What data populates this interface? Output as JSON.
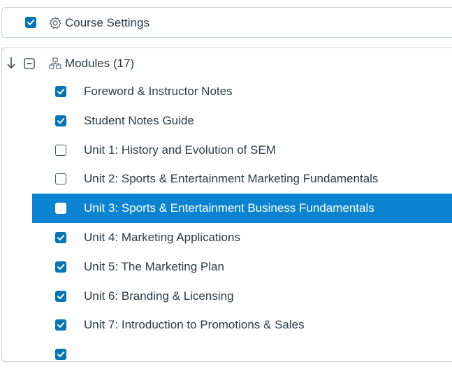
{
  "settings": {
    "label": "Course Settings",
    "checked": true
  },
  "modules": {
    "label": "Modules (17)",
    "items": [
      {
        "label": "Foreword & Instructor Notes",
        "checked": true,
        "selected": false
      },
      {
        "label": "Student Notes Guide",
        "checked": true,
        "selected": false
      },
      {
        "label": "Unit 1: History and Evolution of SEM",
        "checked": false,
        "selected": false
      },
      {
        "label": "Unit 2: Sports & Entertainment Marketing Fundamentals",
        "checked": false,
        "selected": false
      },
      {
        "label": "Unit 3: Sports & Entertainment Business Fundamentals",
        "checked": false,
        "selected": true
      },
      {
        "label": "Unit 4: Marketing Applications",
        "checked": true,
        "selected": false
      },
      {
        "label": "Unit 5: The Marketing Plan",
        "checked": true,
        "selected": false
      },
      {
        "label": "Unit 6: Branding & Licensing",
        "checked": true,
        "selected": false
      },
      {
        "label": "Unit 7: Introduction to Promotions & Sales",
        "checked": true,
        "selected": false
      },
      {
        "label": "",
        "checked": true,
        "selected": false
      }
    ]
  },
  "colors": {
    "checkbox": "#0374b5",
    "selected_row": "#0a84d1",
    "text": "#2d3b45",
    "border": "#c7cdd1"
  }
}
